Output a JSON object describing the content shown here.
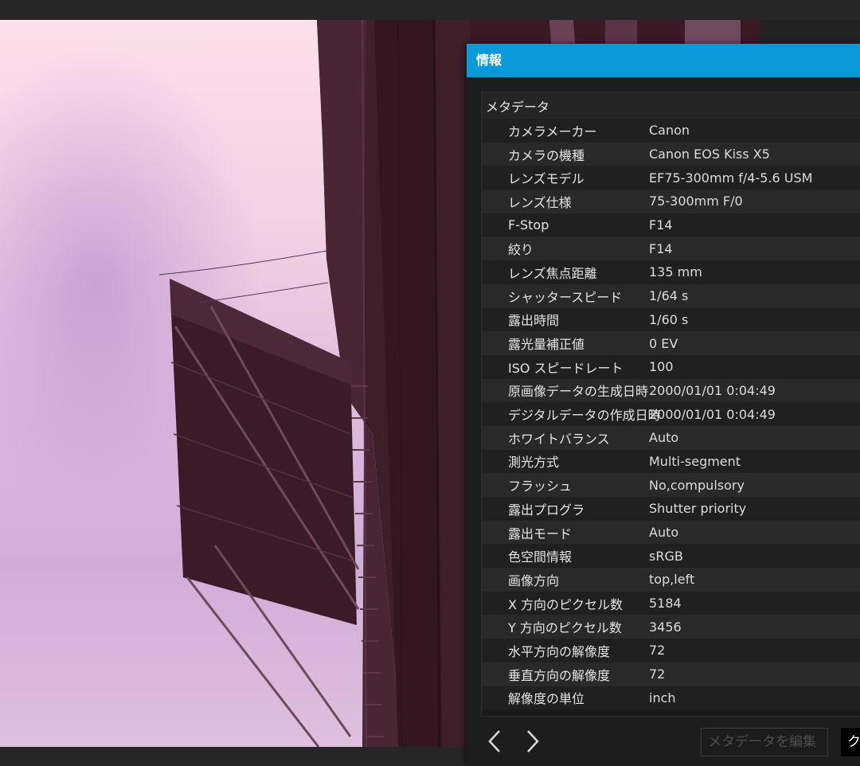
{
  "panel": {
    "title": "情報",
    "section_title": "メタデータ",
    "rows": [
      {
        "key": "カメラメーカー",
        "value": "Canon"
      },
      {
        "key": "カメラの機種",
        "value": "Canon EOS Kiss X5"
      },
      {
        "key": "レンズモデル",
        "value": "EF75-300mm f/4-5.6 USM"
      },
      {
        "key": "レンズ仕様",
        "value": "75-300mm F/0"
      },
      {
        "key": "F-Stop",
        "value": "F14"
      },
      {
        "key": "絞り",
        "value": "F14"
      },
      {
        "key": "レンズ焦点距離",
        "value": "135 mm"
      },
      {
        "key": "シャッタースピード",
        "value": "1/64 s"
      },
      {
        "key": "露出時間",
        "value": "1/60 s"
      },
      {
        "key": "露光量補正値",
        "value": "0 EV"
      },
      {
        "key": "ISO スピードレート",
        "value": "100"
      },
      {
        "key": "原画像データの生成日時",
        "value": "2000/01/01 0:04:49"
      },
      {
        "key": "デジタルデータの作成日時",
        "value": "2000/01/01 0:04:49"
      },
      {
        "key": "ホワイトバランス",
        "value": "Auto"
      },
      {
        "key": "測光方式",
        "value": "Multi-segment"
      },
      {
        "key": "フラッシュ",
        "value": "No,compulsory"
      },
      {
        "key": "露出プログラ",
        "value": "Shutter priority"
      },
      {
        "key": "露出モード",
        "value": "Auto"
      },
      {
        "key": "色空間情報",
        "value": "sRGB"
      },
      {
        "key": "画像方向",
        "value": "top,left"
      },
      {
        "key": "X 方向のピクセル数",
        "value": "5184"
      },
      {
        "key": "Y 方向のピクセル数",
        "value": "3456"
      },
      {
        "key": "水平方向の解像度",
        "value": "72"
      },
      {
        "key": "垂直方向の解像度",
        "value": "72"
      },
      {
        "key": "解像度の単位",
        "value": "inch"
      }
    ],
    "footer": {
      "prev_icon": "chevron-left-icon",
      "next_icon": "chevron-right-icon",
      "edit_label": "メタデータを編集",
      "close_label": "ク"
    }
  },
  "colors": {
    "title_bar": "#0b9ad9",
    "panel_bg": "#1d1d1d"
  }
}
